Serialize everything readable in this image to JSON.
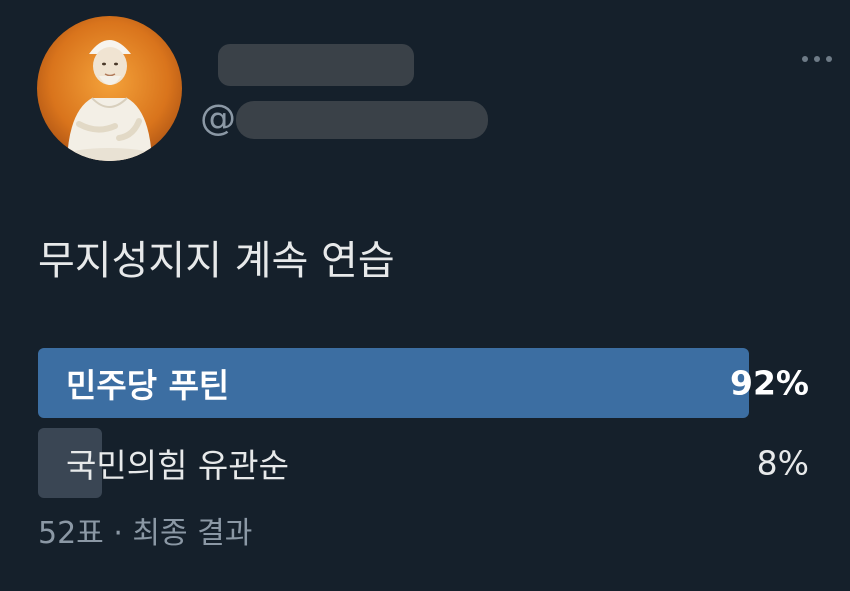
{
  "author": {
    "display_name": "",
    "handle": "@"
  },
  "tweet": {
    "text": "무지성지지 계속 연습"
  },
  "poll": {
    "options": [
      {
        "label": "민주당 푸틴",
        "percent_text": "92%",
        "percent": 92,
        "winner": true
      },
      {
        "label": "국민의힘 유관순",
        "percent_text": "8%",
        "percent": 8,
        "winner": false
      }
    ],
    "votes": "52표",
    "separator": "·",
    "status": "최종 결과"
  },
  "colors": {
    "background": "#15202b",
    "winner_bar": "#3c6ea2",
    "loser_bar": "#3a4654",
    "secondary_text": "#8b98a5"
  },
  "icons": {
    "more": "more-horizontal-icon"
  }
}
